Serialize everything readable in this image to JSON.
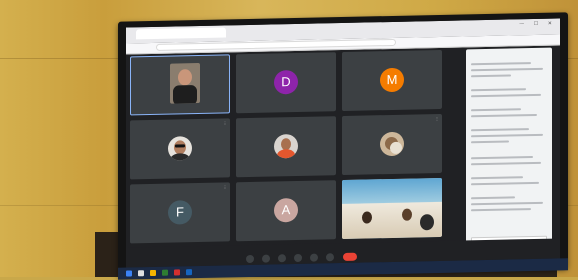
{
  "browser": {
    "tab_title": "",
    "url": "",
    "window_controls": "— ☐ ✕"
  },
  "meet": {
    "tiles": [
      {
        "name": "",
        "kind": "photo"
      },
      {
        "name": "",
        "kind": "letter",
        "letter": "D",
        "color": "#8e24aa"
      },
      {
        "name": "",
        "kind": "letter",
        "letter": "M",
        "color": "#f57c00"
      },
      {
        "name": "",
        "kind": "photo"
      },
      {
        "name": "",
        "kind": "photo"
      },
      {
        "name": "",
        "kind": "photo"
      },
      {
        "name": "",
        "kind": "letter",
        "letter": "F",
        "color": "#455a64"
      },
      {
        "name": "",
        "kind": "letter",
        "letter": "A",
        "color": "#c9a6a0"
      },
      {
        "name": "",
        "kind": "camera"
      }
    ],
    "panel_title": ""
  },
  "bottom": {
    "meeting_id": ""
  },
  "taskbar": {
    "clock": ""
  },
  "colors": {
    "wall": "#cfa946",
    "meet_bg": "#202124",
    "tile_bg": "#3c4043",
    "end_call": "#ea4335"
  }
}
